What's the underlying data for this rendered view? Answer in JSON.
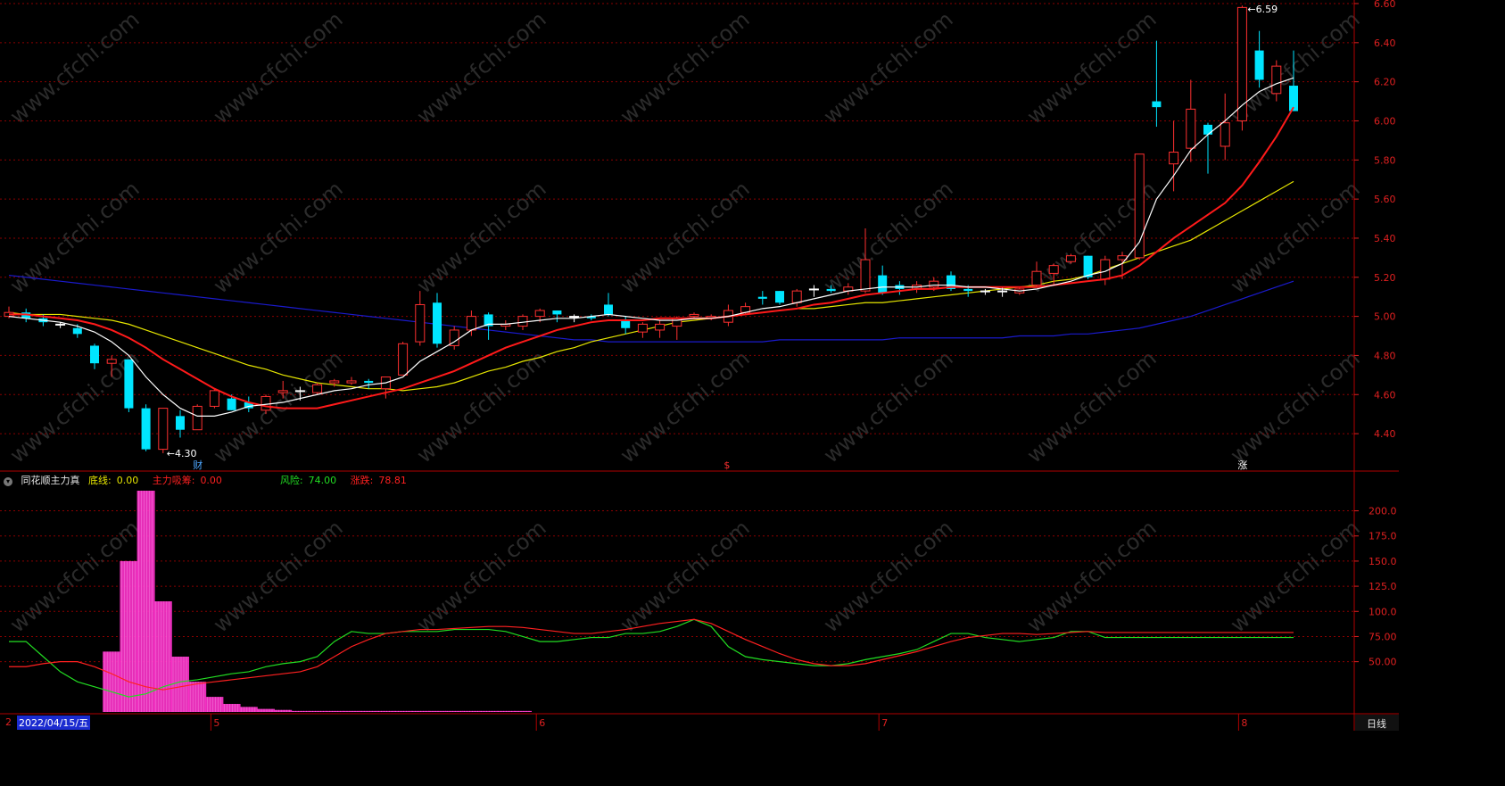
{
  "colors": {
    "background": "#000000",
    "grid": "#8b0000",
    "axis_text": "#e02020",
    "up_candle": "#ff3030",
    "down_candle": "#00e5ff",
    "ma5": "#ffffff",
    "ma10": "#ff1a1a",
    "ma20": "#e6e600",
    "ma60": "#1a1acc",
    "indicator_bar": "#ff33cc",
    "risk_line": "#22dd22",
    "rise_line": "#ff2020"
  },
  "price_panel": {
    "y_ticks": [
      "6.60",
      "6.40",
      "6.20",
      "6.00",
      "5.80",
      "5.60",
      "5.40",
      "5.20",
      "5.00",
      "4.80",
      "4.60",
      "4.40"
    ],
    "high_label": "6.59",
    "low_label": "4.30",
    "markers": [
      {
        "text": "财",
        "color": "#4da6ff"
      },
      {
        "text": "$",
        "color": "#ff3030"
      },
      {
        "text": "涨",
        "color": "#ffffff"
      }
    ]
  },
  "indicator_panel": {
    "icon": "chevron-down-icon",
    "name": "同花顺主力真",
    "fields": [
      {
        "label": "底线:",
        "value": "0.00",
        "color": "#e6e600"
      },
      {
        "label": "主力吸筹:",
        "value": "0.00",
        "color": "#ff2020"
      },
      {
        "label": "风险:",
        "value": "74.00",
        "color": "#22dd22"
      },
      {
        "label": "涨跌:",
        "value": "78.81",
        "color": "#ff2020"
      }
    ],
    "y_ticks": [
      "200.0",
      "175.0",
      "150.0",
      "125.0",
      "100.0",
      "75.00",
      "50.00"
    ]
  },
  "time_axis": {
    "cursor_date": "2022/04/15/五",
    "left_stub": "2",
    "month_labels": [
      "5",
      "6",
      "7",
      "8"
    ],
    "period": "日线"
  },
  "watermark": "www.cfchi.com",
  "chart_data": [
    {
      "type": "candlestick",
      "title": "",
      "ylim": [
        4.3,
        6.6
      ],
      "candles": [
        [
          5.0,
          5.02,
          5.05,
          4.99
        ],
        [
          5.02,
          4.99,
          5.04,
          4.97
        ],
        [
          4.99,
          4.97,
          5.01,
          4.95
        ],
        [
          4.96,
          4.96,
          4.97,
          4.94
        ],
        [
          4.94,
          4.91,
          4.96,
          4.89
        ],
        [
          4.85,
          4.76,
          4.86,
          4.73
        ],
        [
          4.76,
          4.78,
          4.8,
          4.69
        ],
        [
          4.78,
          4.53,
          4.78,
          4.51
        ],
        [
          4.53,
          4.32,
          4.55,
          4.31
        ],
        [
          4.32,
          4.53,
          4.53,
          4.3
        ],
        [
          4.49,
          4.42,
          4.52,
          4.38
        ],
        [
          4.42,
          4.54,
          4.55,
          4.42
        ],
        [
          4.54,
          4.62,
          4.63,
          4.53
        ],
        [
          4.58,
          4.52,
          4.6,
          4.52
        ],
        [
          4.56,
          4.53,
          4.59,
          4.51
        ],
        [
          4.52,
          4.59,
          4.6,
          4.5
        ],
        [
          4.61,
          4.62,
          4.67,
          4.58
        ],
        [
          4.62,
          4.62,
          4.64,
          4.57
        ],
        [
          4.61,
          4.65,
          4.66,
          4.6
        ],
        [
          4.66,
          4.67,
          4.68,
          4.64
        ],
        [
          4.66,
          4.67,
          4.69,
          4.65
        ],
        [
          4.67,
          4.66,
          4.68,
          4.63
        ],
        [
          4.63,
          4.69,
          4.69,
          4.58
        ],
        [
          4.7,
          4.86,
          4.87,
          4.7
        ],
        [
          4.87,
          5.06,
          5.13,
          4.85
        ],
        [
          5.07,
          4.86,
          5.12,
          4.84
        ],
        [
          4.85,
          4.93,
          4.95,
          4.83
        ],
        [
          4.93,
          5.0,
          5.03,
          4.9
        ],
        [
          5.01,
          4.95,
          5.02,
          4.88
        ],
        [
          4.95,
          4.96,
          4.98,
          4.93
        ],
        [
          4.95,
          5.0,
          5.01,
          4.93
        ],
        [
          5.0,
          5.03,
          5.04,
          4.97
        ],
        [
          5.03,
          5.01,
          5.03,
          4.97
        ],
        [
          5.0,
          5.0,
          5.01,
          4.97
        ],
        [
          5.0,
          4.99,
          5.01,
          4.98
        ],
        [
          5.06,
          5.01,
          5.12,
          5.0
        ],
        [
          4.98,
          4.94,
          5.0,
          4.91
        ],
        [
          4.92,
          4.96,
          4.97,
          4.89
        ],
        [
          4.93,
          4.96,
          4.98,
          4.89
        ],
        [
          4.95,
          4.99,
          5.0,
          4.88
        ],
        [
          5.0,
          5.01,
          5.02,
          4.99
        ],
        [
          4.99,
          5.0,
          5.01,
          4.98
        ],
        [
          4.97,
          5.03,
          5.06,
          4.95
        ],
        [
          5.02,
          5.05,
          5.07,
          5.01
        ],
        [
          5.1,
          5.09,
          5.13,
          5.06
        ],
        [
          5.13,
          5.07,
          5.13,
          5.06
        ],
        [
          5.07,
          5.13,
          5.14,
          5.05
        ],
        [
          5.14,
          5.14,
          5.16,
          5.1
        ],
        [
          5.14,
          5.13,
          5.16,
          5.12
        ],
        [
          5.13,
          5.15,
          5.17,
          5.11
        ],
        [
          5.13,
          5.29,
          5.45,
          5.12
        ],
        [
          5.21,
          5.12,
          5.26,
          5.11
        ],
        [
          5.16,
          5.14,
          5.18,
          5.11
        ],
        [
          5.14,
          5.16,
          5.18,
          5.12
        ],
        [
          5.15,
          5.18,
          5.2,
          5.13
        ],
        [
          5.21,
          5.14,
          5.23,
          5.13
        ],
        [
          5.14,
          5.13,
          5.16,
          5.1
        ],
        [
          5.13,
          5.13,
          5.14,
          5.11
        ],
        [
          5.13,
          5.13,
          5.15,
          5.1
        ],
        [
          5.12,
          5.14,
          5.15,
          5.11
        ],
        [
          5.16,
          5.23,
          5.28,
          5.15
        ],
        [
          5.22,
          5.26,
          5.27,
          5.16
        ],
        [
          5.28,
          5.31,
          5.32,
          5.27
        ],
        [
          5.31,
          5.2,
          5.31,
          5.19
        ],
        [
          5.19,
          5.29,
          5.31,
          5.16
        ],
        [
          5.29,
          5.31,
          5.33,
          5.19
        ],
        [
          5.3,
          5.83,
          5.83,
          5.29
        ],
        [
          6.1,
          6.07,
          6.41,
          5.97
        ],
        [
          5.78,
          5.84,
          6.0,
          5.64
        ],
        [
          5.86,
          6.06,
          6.21,
          5.79
        ],
        [
          5.98,
          5.93,
          5.99,
          5.73
        ],
        [
          5.87,
          5.99,
          6.14,
          5.8
        ],
        [
          6.0,
          6.58,
          6.59,
          5.95
        ],
        [
          6.36,
          6.21,
          6.46,
          6.17
        ],
        [
          6.14,
          6.28,
          6.31,
          6.1
        ],
        [
          6.18,
          6.05,
          6.36,
          6.05
        ]
      ],
      "ma5": [
        5.0,
        4.99,
        4.98,
        4.97,
        4.95,
        4.92,
        4.87,
        4.8,
        4.69,
        4.6,
        4.53,
        4.49,
        4.49,
        4.51,
        4.54,
        4.55,
        4.56,
        4.58,
        4.6,
        4.62,
        4.63,
        4.65,
        4.66,
        4.69,
        4.77,
        4.82,
        4.87,
        4.93,
        4.96,
        4.96,
        4.97,
        4.98,
        4.99,
        4.99,
        5.0,
        5.01,
        5.0,
        4.99,
        4.98,
        4.98,
        4.99,
        4.99,
        5.0,
        5.02,
        5.04,
        5.05,
        5.07,
        5.09,
        5.11,
        5.13,
        5.14,
        5.15,
        5.15,
        5.15,
        5.16,
        5.16,
        5.15,
        5.15,
        5.14,
        5.13,
        5.14,
        5.16,
        5.18,
        5.21,
        5.23,
        5.27,
        5.38,
        5.6,
        5.72,
        5.85,
        5.93,
        6.0,
        6.08,
        6.15,
        6.19,
        6.22
      ],
      "ma10": [
        5.01,
        5.01,
        5.0,
        4.99,
        4.98,
        4.96,
        4.93,
        4.89,
        4.84,
        4.78,
        4.73,
        4.68,
        4.63,
        4.59,
        4.56,
        4.54,
        4.53,
        4.53,
        4.53,
        4.55,
        4.57,
        4.59,
        4.61,
        4.63,
        4.66,
        4.69,
        4.72,
        4.76,
        4.8,
        4.84,
        4.87,
        4.9,
        4.93,
        4.95,
        4.97,
        4.98,
        4.98,
        4.98,
        4.99,
        4.99,
        4.99,
        4.99,
        5.0,
        5.01,
        5.02,
        5.03,
        5.04,
        5.06,
        5.07,
        5.09,
        5.11,
        5.12,
        5.13,
        5.14,
        5.14,
        5.15,
        5.15,
        5.15,
        5.15,
        5.15,
        5.15,
        5.16,
        5.17,
        5.18,
        5.19,
        5.21,
        5.26,
        5.33,
        5.4,
        5.46,
        5.52,
        5.58,
        5.67,
        5.79,
        5.92,
        6.07
      ],
      "ma20": [
        5.02,
        5.01,
        5.01,
        5.01,
        5.0,
        4.99,
        4.98,
        4.96,
        4.93,
        4.9,
        4.87,
        4.84,
        4.81,
        4.78,
        4.75,
        4.73,
        4.7,
        4.68,
        4.66,
        4.65,
        4.64,
        4.63,
        4.63,
        4.62,
        4.63,
        4.64,
        4.66,
        4.69,
        4.72,
        4.74,
        4.77,
        4.79,
        4.82,
        4.84,
        4.87,
        4.89,
        4.91,
        4.93,
        4.95,
        4.97,
        4.98,
        4.99,
        5.0,
        5.01,
        5.02,
        5.03,
        5.04,
        5.04,
        5.05,
        5.06,
        5.07,
        5.07,
        5.08,
        5.09,
        5.1,
        5.11,
        5.12,
        5.13,
        5.14,
        5.15,
        5.16,
        5.18,
        5.19,
        5.21,
        5.24,
        5.27,
        5.3,
        5.33,
        5.36,
        5.39,
        5.44,
        5.49,
        5.54,
        5.59,
        5.64,
        5.69
      ],
      "ma60": [
        5.21,
        5.2,
        5.19,
        5.18,
        5.17,
        5.16,
        5.15,
        5.14,
        5.13,
        5.12,
        5.11,
        5.1,
        5.09,
        5.08,
        5.07,
        5.06,
        5.05,
        5.04,
        5.03,
        5.02,
        5.01,
        5.0,
        4.99,
        4.98,
        4.97,
        4.96,
        4.95,
        4.94,
        4.93,
        4.92,
        4.91,
        4.9,
        4.89,
        4.88,
        4.88,
        4.87,
        4.87,
        4.87,
        4.87,
        4.87,
        4.87,
        4.87,
        4.87,
        4.87,
        4.87,
        4.88,
        4.88,
        4.88,
        4.88,
        4.88,
        4.88,
        4.88,
        4.89,
        4.89,
        4.89,
        4.89,
        4.89,
        4.89,
        4.89,
        4.9,
        4.9,
        4.9,
        4.91,
        4.91,
        4.92,
        4.93,
        4.94,
        4.96,
        4.98,
        5.0,
        5.03,
        5.06,
        5.09,
        5.12,
        5.15,
        5.18
      ]
    },
    {
      "type": "bar+line",
      "title": "同花顺主力真",
      "ylim": [
        0,
        220
      ],
      "bars": [
        0,
        0,
        0,
        0,
        0,
        0,
        60,
        150,
        220,
        110,
        55,
        30,
        15,
        8,
        5,
        3,
        2,
        1,
        1,
        1,
        1,
        1,
        1,
        1,
        1,
        1,
        1,
        1,
        1,
        1,
        1,
        0,
        0,
        0,
        0,
        0,
        0,
        0,
        0,
        0,
        0,
        0,
        0,
        0,
        0,
        0,
        0,
        0,
        0,
        0,
        0,
        0,
        0,
        0,
        0,
        0,
        0,
        0,
        0,
        0,
        0,
        0,
        0,
        0,
        0,
        0,
        0,
        0,
        0,
        0,
        0,
        0,
        0,
        0,
        0,
        0
      ],
      "series": [
        {
          "name": "风险",
          "values": [
            70,
            70,
            55,
            40,
            30,
            25,
            20,
            15,
            18,
            25,
            30,
            32,
            35,
            38,
            40,
            45,
            48,
            50,
            55,
            70,
            80,
            78,
            78,
            80,
            80,
            80,
            82,
            82,
            82,
            80,
            75,
            70,
            70,
            72,
            74,
            74,
            78,
            78,
            80,
            85,
            92,
            85,
            65,
            55,
            52,
            50,
            48,
            46,
            46,
            48,
            52,
            55,
            58,
            62,
            70,
            78,
            78,
            74,
            72,
            70,
            72,
            74,
            80,
            80,
            74,
            74,
            74,
            74,
            74,
            74,
            74,
            74,
            74,
            74,
            74,
            74
          ]
        },
        {
          "name": "涨跌",
          "values": [
            45,
            45,
            48,
            50,
            50,
            45,
            38,
            30,
            25,
            22,
            25,
            28,
            30,
            32,
            34,
            36,
            38,
            40,
            45,
            55,
            65,
            72,
            78,
            80,
            82,
            82,
            83,
            84,
            85,
            85,
            84,
            82,
            80,
            78,
            78,
            80,
            82,
            85,
            88,
            90,
            92,
            88,
            80,
            72,
            65,
            58,
            52,
            48,
            46,
            46,
            48,
            52,
            56,
            60,
            65,
            70,
            74,
            76,
            78,
            78,
            77,
            78,
            79,
            80,
            79,
            79,
            79,
            79,
            79,
            79,
            79,
            79,
            79,
            79,
            79,
            79
          ]
        }
      ]
    }
  ]
}
